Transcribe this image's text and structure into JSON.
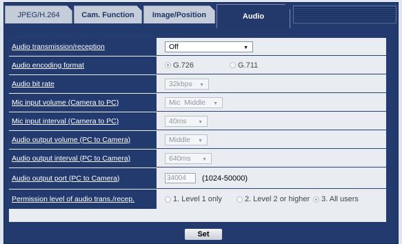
{
  "tabs": [
    "JPEG/H.264",
    "Cam. Function",
    "Image/Position",
    "Audio"
  ],
  "rows": [
    {
      "label": "Audio transmission/reception",
      "value": "Off"
    },
    {
      "label": "Audio encoding  format",
      "options": [
        "G.726",
        "G.711"
      ],
      "selected": "G.726"
    },
    {
      "label": "Audio bit rate",
      "value": "32kbps"
    },
    {
      "label": "Mic input volume (Camera to PC)",
      "value": "Mic  Middle"
    },
    {
      "label": "Mic input interval (Camera to PC)",
      "value": "40ms"
    },
    {
      "label": "Audio output volume (PC to Camera)",
      "value": "Middle"
    },
    {
      "label": "Audio output interval (PC to Camera)",
      "value": "640ms"
    },
    {
      "label": "Audio output port (PC to Camera)",
      "value": "34004",
      "range": "(1024-50000)"
    },
    {
      "label": "Permission level of audio trans./recep.",
      "options": [
        "1. Level 1 only",
        "2. Level 2 or higher",
        "3. All users"
      ],
      "selected": "3. All users"
    }
  ],
  "set_button": "Set",
  "colors": {
    "header_bg": "#233a6e",
    "panel_bg": "#e9edf2",
    "tab_inactive": "#c4cdd9",
    "page_bg": "#dfe6ef"
  }
}
